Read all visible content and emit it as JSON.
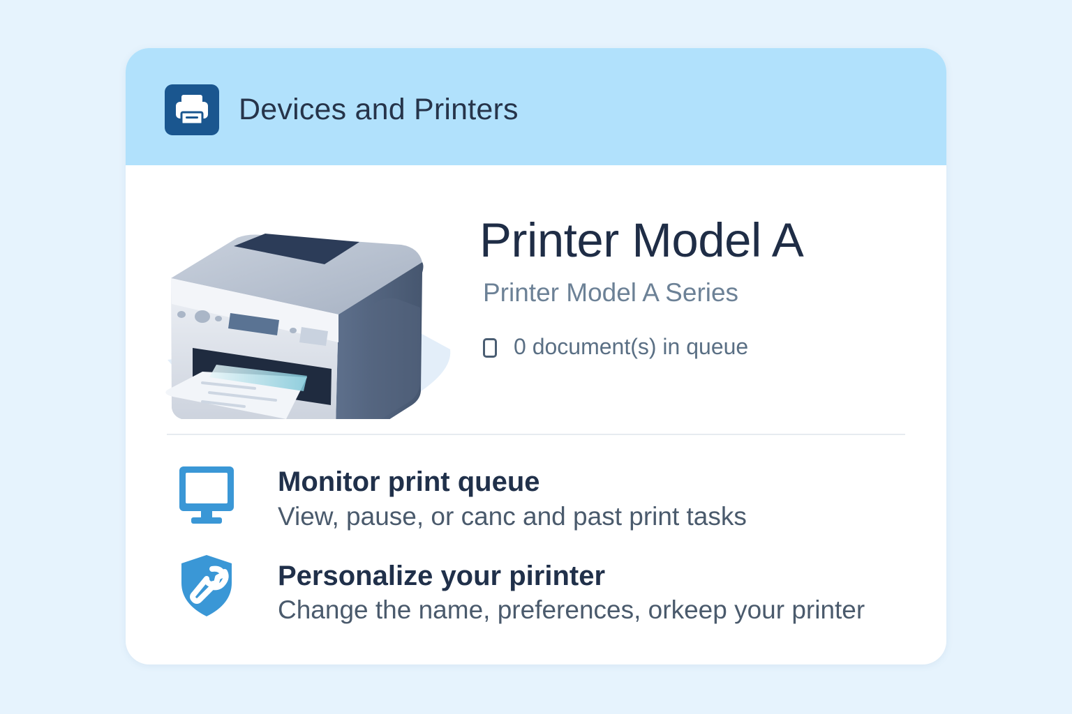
{
  "header": {
    "title": "Devices and Printers",
    "icon": "printer-icon"
  },
  "device": {
    "model_name": "Printer Model A",
    "series": "Printer Model A Series",
    "queue_status": "0 document(s) in queue",
    "queue_icon": "document-icon"
  },
  "actions": [
    {
      "title": "Monitor print queue",
      "description": "View, pause, or canc and past print tasks",
      "icon": "monitor-icon"
    },
    {
      "title": "Personalize your pirinter",
      "description": "Change the name, preferences, orkeep your printer",
      "icon": "shield-wrench-icon"
    }
  ],
  "colors": {
    "background": "#e6f3fd",
    "header_background": "#b1e1fc",
    "header_icon_background": "#1a568f",
    "accent_icon": "#3a97d6",
    "title_text": "#1f2d46"
  }
}
